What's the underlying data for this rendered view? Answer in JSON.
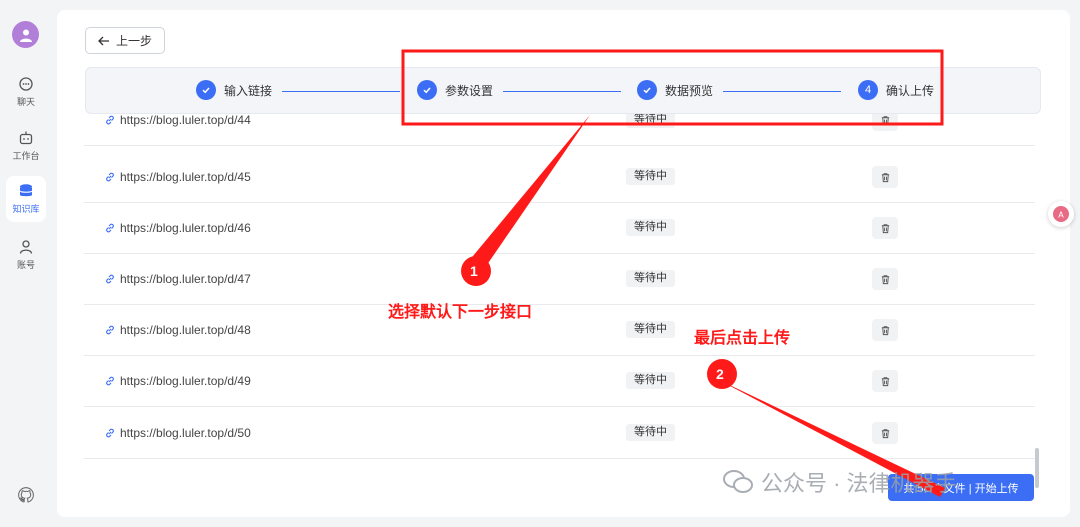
{
  "sidebar": {
    "items": [
      {
        "label": "聊天",
        "icon": "chat-icon"
      },
      {
        "label": "工作台",
        "icon": "robot-icon"
      },
      {
        "label": "知识库",
        "icon": "database-icon"
      },
      {
        "label": "账号",
        "icon": "user-icon"
      }
    ],
    "active": "知识库"
  },
  "header": {
    "back_label": "上一步"
  },
  "steps": [
    {
      "label": "输入链接",
      "state": "done"
    },
    {
      "label": "参数设置",
      "state": "done"
    },
    {
      "label": "数据预览",
      "state": "done"
    },
    {
      "label": "确认上传",
      "state": "current",
      "number": "4"
    }
  ],
  "rows": [
    {
      "url": "https://blog.luler.top/d/44",
      "status": "等待中"
    },
    {
      "url": "https://blog.luler.top/d/45",
      "status": "等待中"
    },
    {
      "url": "https://blog.luler.top/d/46",
      "status": "等待中"
    },
    {
      "url": "https://blog.luler.top/d/47",
      "status": "等待中"
    },
    {
      "url": "https://blog.luler.top/d/48",
      "status": "等待中"
    },
    {
      "url": "https://blog.luler.top/d/49",
      "status": "等待中"
    },
    {
      "url": "https://blog.luler.top/d/50",
      "status": "等待中"
    }
  ],
  "upload_button": "共 50 个文件 | 开始上传",
  "annotations": {
    "marker1": "1",
    "text1": "选择默认下一步接口",
    "marker2": "2",
    "text2": "最后点击上传"
  },
  "watermark": "公众号 · 法律机器手",
  "colors": {
    "accent": "#3b6ef5",
    "annotation": "#ff1a1a"
  }
}
